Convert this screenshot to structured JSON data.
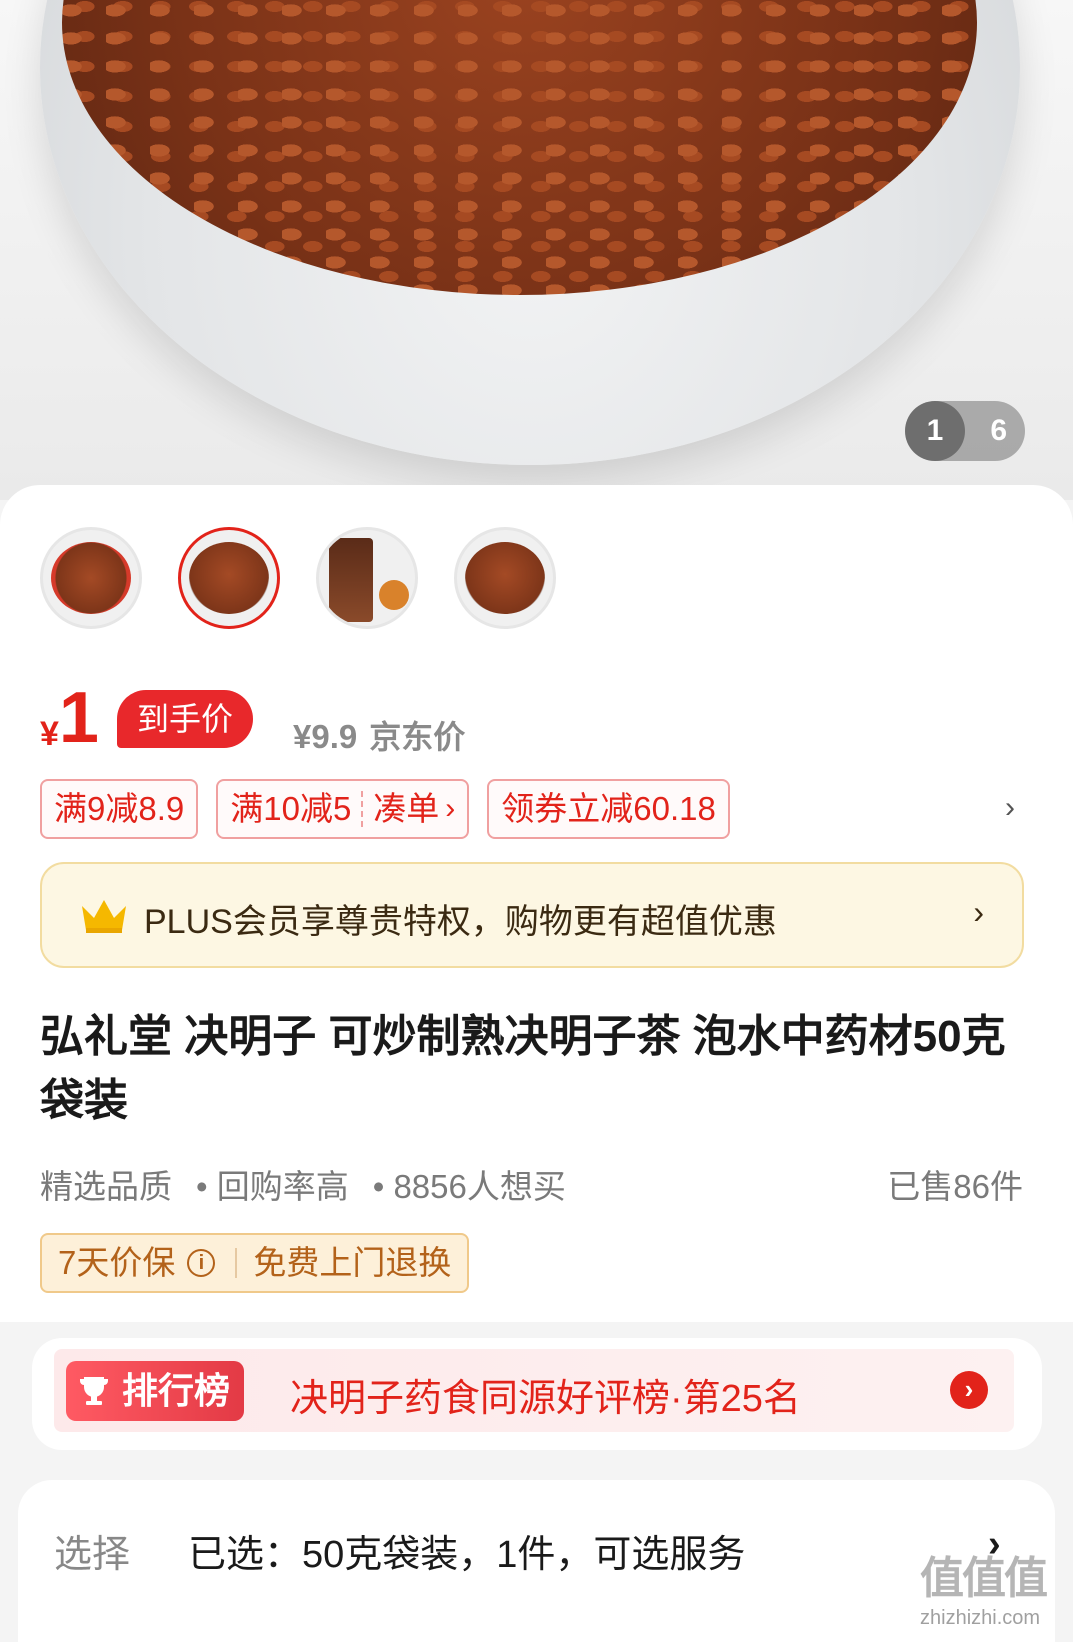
{
  "gallery": {
    "current_page": "1",
    "total_pages": "6",
    "thumbnails": [
      {
        "name": "thumb-1"
      },
      {
        "name": "thumb-2",
        "selected": true
      },
      {
        "name": "thumb-3"
      },
      {
        "name": "thumb-4"
      }
    ]
  },
  "price": {
    "currency": "¥",
    "final": "1",
    "final_label": "到手价",
    "jd_price": "¥9.9",
    "jd_price_label": "京东价"
  },
  "coupons": [
    {
      "text": "满9减8.9"
    },
    {
      "text": "满10减5",
      "action": "凑单"
    },
    {
      "text": "领券立减60.18"
    }
  ],
  "plus_banner": {
    "text": "PLUS会员享尊贵特权，购物更有超值优惠"
  },
  "product": {
    "title": "弘礼堂 决明子 可炒制熟决明子茶 泡水中药材50克袋装",
    "tags": [
      "精选品质",
      "• 回购率高",
      "• 8856人想买"
    ],
    "sold": "已售86件"
  },
  "guarantee": {
    "price_protect": "7天价保",
    "return": "免费上门退换"
  },
  "ranking": {
    "badge": "排行榜",
    "text": "决明子药食同源好评榜·第25名"
  },
  "selection": {
    "label": "选择",
    "value": "已选：50克袋装，1件，可选服务"
  },
  "watermark": {
    "logo": "值值值",
    "url": "zhizhizhi.com"
  },
  "colors": {
    "accent_red": "#e2231a",
    "plus_bg": "#fdf7e3",
    "guarantee_bg": "#fdf0d9"
  }
}
